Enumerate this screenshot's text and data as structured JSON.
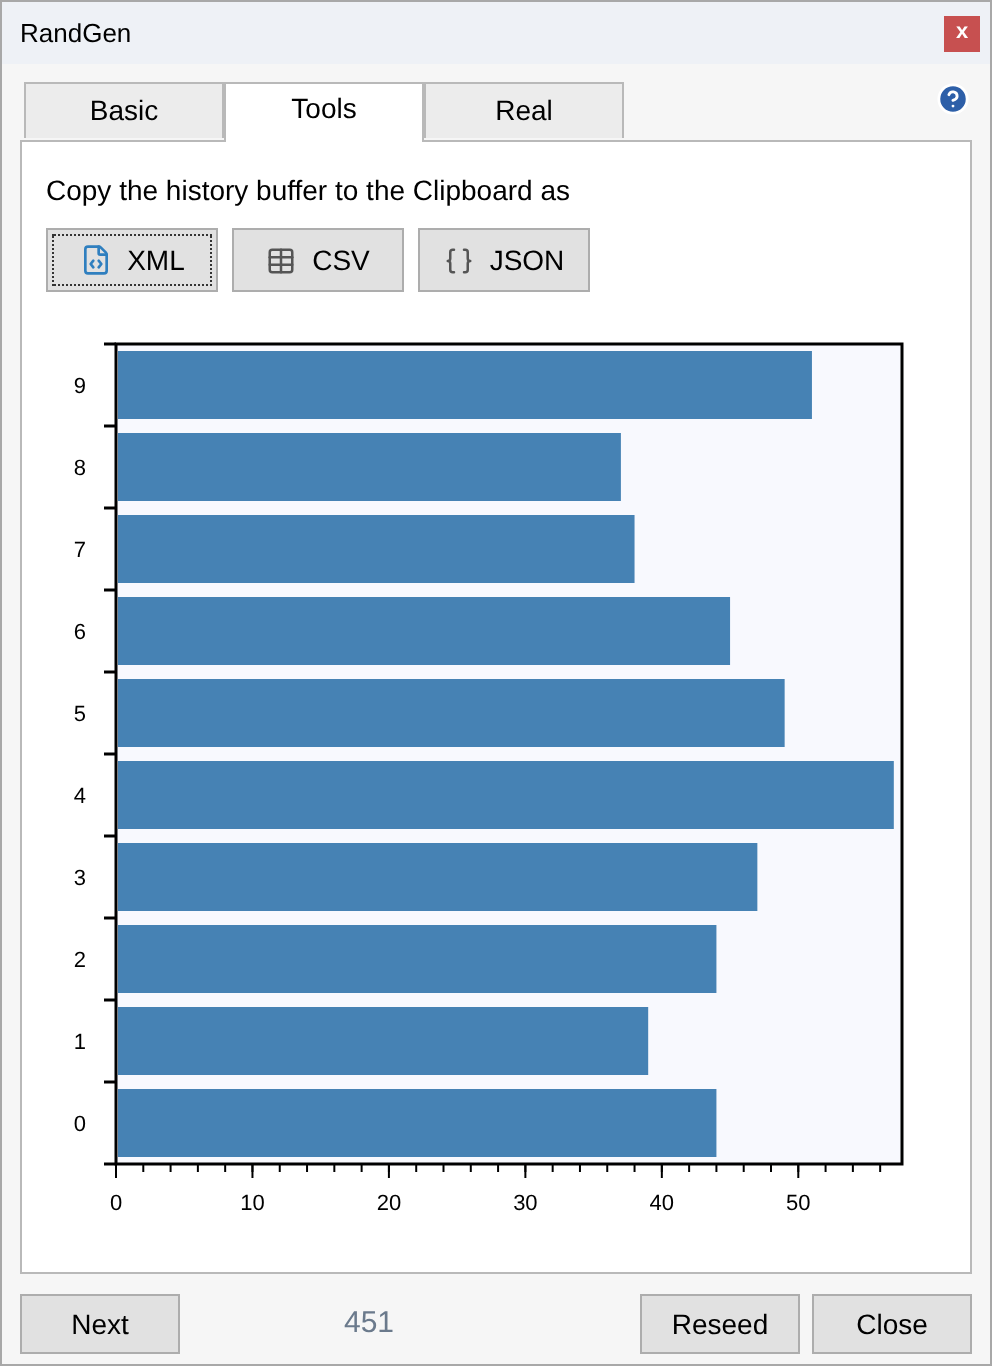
{
  "window": {
    "title": "RandGen",
    "close_label": "x"
  },
  "tabs": [
    {
      "label": "Basic",
      "selected": false
    },
    {
      "label": "Tools",
      "selected": true
    },
    {
      "label": "Real",
      "selected": false
    }
  ],
  "prompt": "Copy the history buffer to the Clipboard as",
  "copy_buttons": [
    {
      "label": "XML",
      "kind": "xml",
      "focused": true
    },
    {
      "label": "CSV",
      "kind": "csv",
      "focused": false
    },
    {
      "label": "JSON",
      "kind": "json",
      "focused": false
    }
  ],
  "chart_data": {
    "type": "bar",
    "orientation": "horizontal",
    "categories": [
      "9",
      "8",
      "7",
      "6",
      "5",
      "4",
      "3",
      "2",
      "1",
      "0"
    ],
    "values": [
      51,
      37,
      38,
      45,
      49,
      57,
      47,
      44,
      39,
      44
    ],
    "xlim": [
      0,
      57.6
    ],
    "xticks": [
      0,
      10,
      20,
      30,
      40,
      50
    ]
  },
  "footer": {
    "next": "Next",
    "count": "451",
    "reseed": "Reseed",
    "close": "Close"
  }
}
